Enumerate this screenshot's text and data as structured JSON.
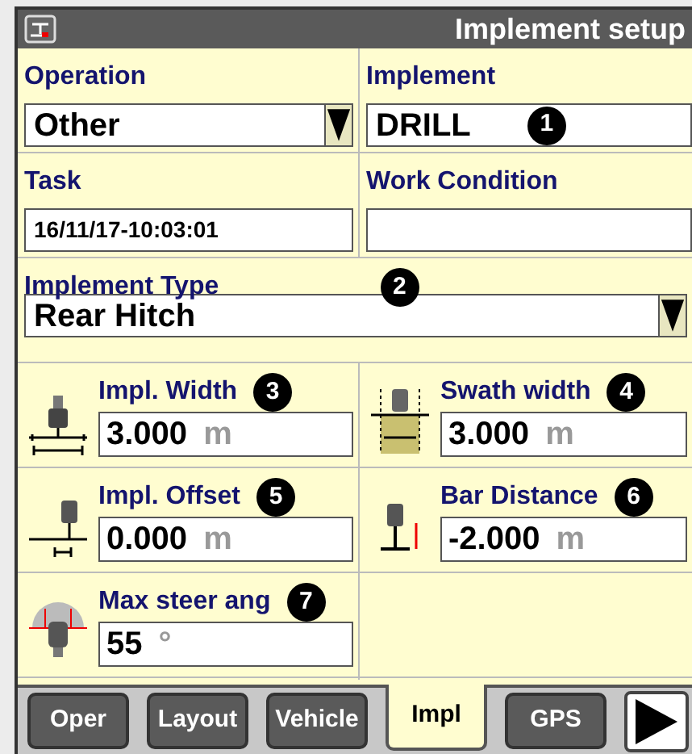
{
  "window": {
    "title": "Implement setup"
  },
  "rows": [
    {
      "cells": [
        {
          "label": "Operation",
          "kind": "dropdown",
          "value": "Other"
        },
        {
          "label": "Implement",
          "kind": "text",
          "value": "DRILL",
          "badge": "1"
        }
      ]
    },
    {
      "cells": [
        {
          "label": "Task",
          "kind": "small",
          "value": "16/11/17-10:03:01"
        },
        {
          "label": "Work Condition",
          "kind": "small"
        }
      ]
    },
    {
      "cells": [
        {
          "label": "Implement Type",
          "kind": "dropdown",
          "value": "Rear Hitch",
          "badge": "2"
        }
      ]
    },
    {
      "cells": [
        {
          "label": "Impl. Width",
          "kind": "measure",
          "value": "3.000",
          "unit": "m",
          "badge": "3"
        },
        {
          "label": "Swath width",
          "kind": "measure",
          "value": "3.000",
          "unit": "m",
          "badge": "4"
        }
      ]
    },
    {
      "cells": [
        {
          "label": "Impl. Offset",
          "kind": "measure",
          "value": "0.000",
          "unit": "m",
          "badge": "5"
        },
        {
          "label": "Bar Distance",
          "kind": "measure",
          "value": "-2.000",
          "unit": "m",
          "badge": "6"
        }
      ]
    },
    {
      "cells": [
        {
          "label": "Max steer ang",
          "kind": "measure",
          "value": "55",
          "unit": "°",
          "badge": "7"
        }
      ]
    }
  ],
  "tabs": [
    {
      "label": "Oper",
      "selected": false
    },
    {
      "label": "Layout",
      "selected": false
    },
    {
      "label": "Vehicle",
      "selected": false
    },
    {
      "label": "Impl",
      "selected": true
    },
    {
      "label": "GPS",
      "selected": false
    }
  ]
}
